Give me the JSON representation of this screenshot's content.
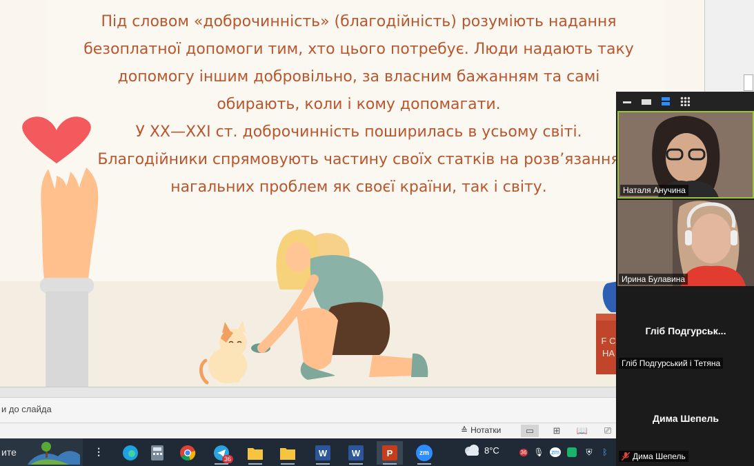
{
  "slide": {
    "lines": [
      "Під словом «доброчинність» (благодійність) розуміють надання",
      "безоплатної допомоги тим, хто цього потребує. Люди надають таку",
      "допомогу іншим добровільно, за власним бажанням та самі",
      "обирають, коли і кому допомагати.",
      "У ХХ—ХХІ ст. доброчинність поширилась в усьому світі.",
      "Благодійники спрямовують частину своїх статків на розв’язання",
      "нагальних проблем як своєї країни, так і світу."
    ],
    "text_color": "#b6572f",
    "box_label": "F CHA"
  },
  "notes": {
    "placeholder": "и до слайда"
  },
  "status": {
    "notes_label": "Нотатки"
  },
  "taskbar": {
    "search_stub": "ите",
    "telegram_badge": "36",
    "word_label": "W",
    "ppt_label": "P",
    "zoom_label": "zm",
    "weather": "8°C",
    "tray_badge": "36",
    "tray_zoom": "zm"
  },
  "zoom": {
    "participants": [
      {
        "name": "Наталя Анучина"
      },
      {
        "name": "Ирина Булавина"
      },
      {
        "display": "Гліб  Подгурськ...",
        "name": "Гліб Подгурський і Тетяна"
      },
      {
        "display": "Дима Шепель",
        "name": "Дима Шепель",
        "muted": true
      }
    ],
    "active_speaker_color": "#9ac43a"
  }
}
